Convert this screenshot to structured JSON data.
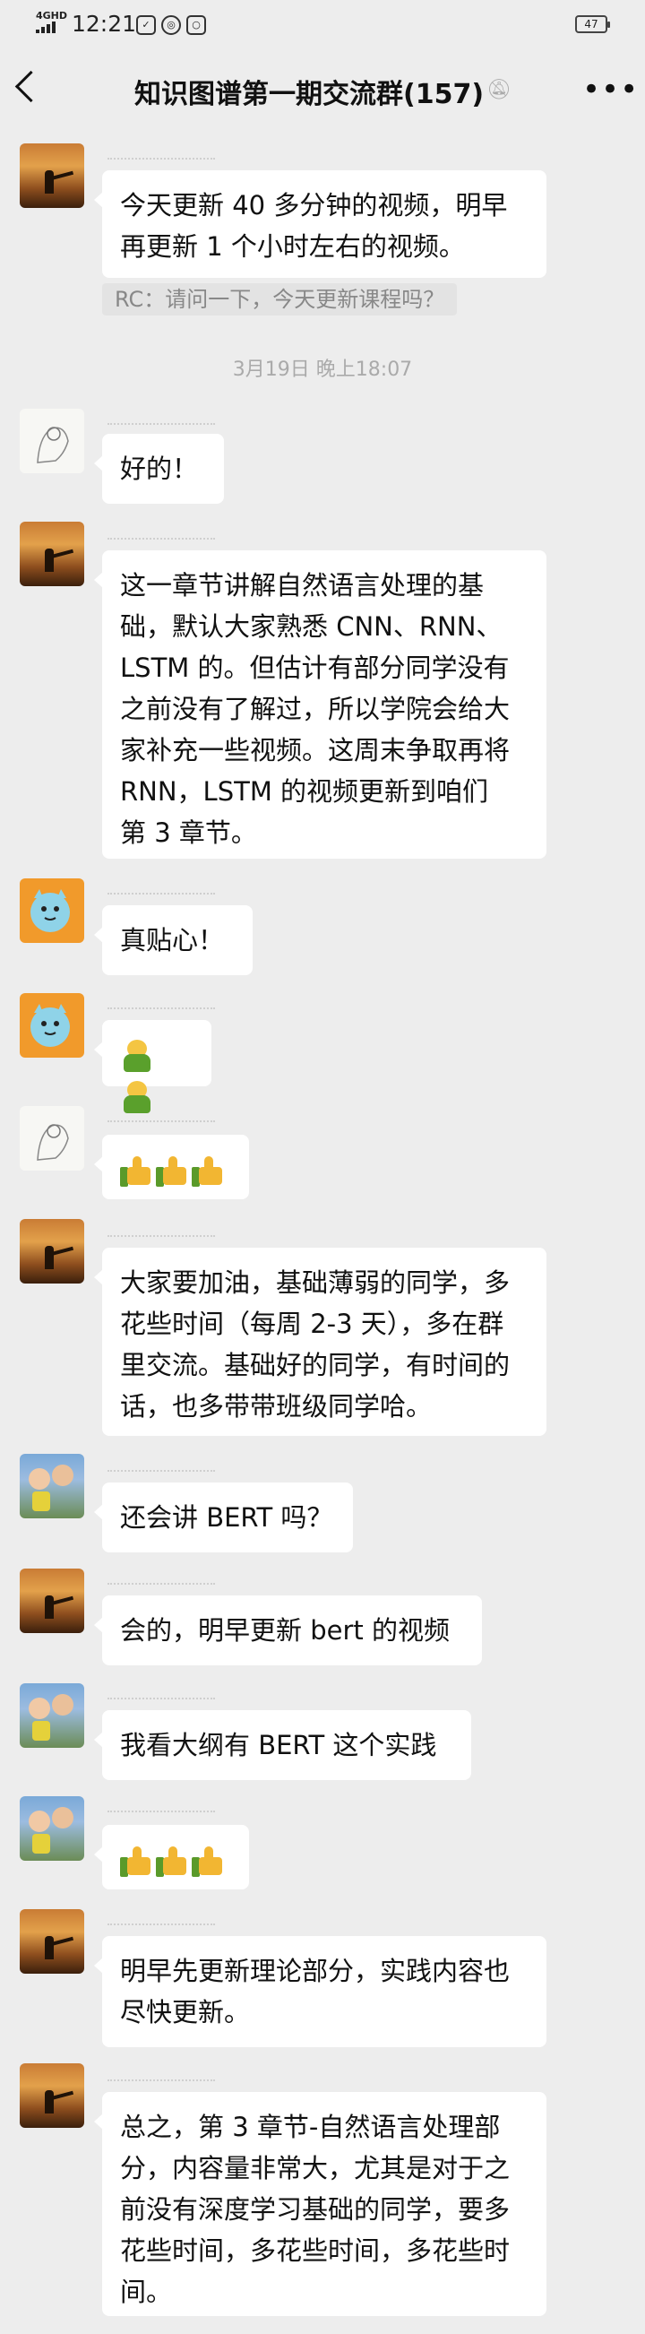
{
  "status_bar": {
    "network": "4GHD",
    "time": "12:21",
    "battery": "47"
  },
  "nav": {
    "title": "知识图谱第一期交流群(157)"
  },
  "chat": {
    "timestamp": "3月19日 晚上18:07",
    "quote": "RC：请问一下，今天更新课程吗？",
    "messages": [
      {
        "text": "今天更新 40 多分钟的视频，明早\n再更新 1 个小时左右的视频。"
      },
      {
        "text": "好的！"
      },
      {
        "text": "这一章节讲解自然语言处理的基\n础，默认大家熟悉 CNN、RNN、\nLSTM 的。但估计有部分同学没有\n之前没有了解过，所以学院会给大\n家补充一些视频。这周末争取再将\nRNN，LSTM 的视频更新到咱们\n第 3 章节。"
      },
      {
        "text": "真贴心！"
      },
      {
        "text": ""
      },
      {
        "text": ""
      },
      {
        "text": "大家要加油，基础薄弱的同学，多\n花些时间（每周 2-3 天），多在群\n里交流。基础好的同学，有时间的\n话，也多带带班级同学哈。"
      },
      {
        "text": "还会讲 BERT 吗？"
      },
      {
        "text": "会的，明早更新 bert 的视频"
      },
      {
        "text": "我看大纲有 BERT 这个实践"
      },
      {
        "text": ""
      },
      {
        "text": "明早先更新理论部分，实践内容也\n尽快更新。"
      },
      {
        "text": "总之，第 3 章节-自然语言处理部\n分，内容量非常大，尤其是对于之\n前没有深度学习基础的同学，要多\n花些时间，多花些时间，多花些时\n间。"
      }
    ]
  }
}
